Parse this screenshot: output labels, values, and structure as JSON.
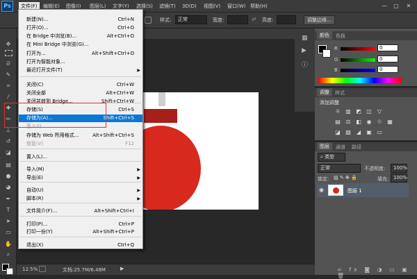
{
  "menubar": {
    "logo": "Ps",
    "items": [
      {
        "label": "文件(F)"
      },
      {
        "label": "编辑(E)"
      },
      {
        "label": "图像(I)"
      },
      {
        "label": "图层(L)"
      },
      {
        "label": "文字(Y)"
      },
      {
        "label": "选择(S)"
      },
      {
        "label": "滤镜(T)"
      },
      {
        "label": "3D(D)"
      },
      {
        "label": "视图(V)"
      },
      {
        "label": "窗口(W)"
      },
      {
        "label": "帮助(H)"
      }
    ],
    "window_buttons": [
      "—",
      "□",
      "✕"
    ]
  },
  "options": {
    "style_label": "样式:",
    "style_value": "正常",
    "width_label": "宽度:",
    "height_label": "高度:",
    "refine_edge": "调整边缘..."
  },
  "file_menu": {
    "items": [
      {
        "label": "新建(N)...",
        "shortcut": "Ctrl+N",
        "state": "normal",
        "submenu": false
      },
      {
        "label": "打开(O)...",
        "shortcut": "Ctrl+O",
        "state": "normal",
        "submenu": false
      },
      {
        "label": "在 Bridge 中浏览(B)...",
        "shortcut": "Alt+Ctrl+O",
        "state": "normal",
        "submenu": false
      },
      {
        "label": "在 Mini Bridge 中浏览(G)...",
        "shortcut": "",
        "state": "normal",
        "submenu": false
      },
      {
        "label": "打开为...",
        "shortcut": "Alt+Shift+Ctrl+O",
        "state": "normal",
        "submenu": false
      },
      {
        "label": "打开为智能对象...",
        "shortcut": "",
        "state": "normal",
        "submenu": false
      },
      {
        "label": "最近打开文件(T)",
        "shortcut": "",
        "state": "normal",
        "submenu": true
      },
      {
        "label": "关闭(C)",
        "shortcut": "Ctrl+W",
        "state": "normal",
        "submenu": false
      },
      {
        "label": "关闭全部",
        "shortcut": "Alt+Ctrl+W",
        "state": "normal",
        "submenu": false
      },
      {
        "label": "关闭并转到 Bridge...",
        "shortcut": "Shift+Ctrl+W",
        "state": "normal",
        "submenu": false
      },
      {
        "label": "存储(S)",
        "shortcut": "Ctrl+S",
        "state": "normal",
        "submenu": false
      },
      {
        "label": "存储为(A)...",
        "shortcut": "Shift+Ctrl+S",
        "state": "highlight",
        "submenu": false
      },
      {
        "label": "签入(I)...",
        "shortcut": "",
        "state": "disabled",
        "submenu": false
      },
      {
        "label": "存储为 Web 所用格式...",
        "shortcut": "Alt+Shift+Ctrl+S",
        "state": "normal",
        "submenu": false
      },
      {
        "label": "恢复(V)",
        "shortcut": "F12",
        "state": "disabled",
        "submenu": false
      },
      {
        "label": "置入(L)...",
        "shortcut": "",
        "state": "normal",
        "submenu": false
      },
      {
        "label": "导入(M)",
        "shortcut": "",
        "state": "normal",
        "submenu": true
      },
      {
        "label": "导出(E)",
        "shortcut": "",
        "state": "normal",
        "submenu": true
      },
      {
        "label": "自动(U)",
        "shortcut": "",
        "state": "normal",
        "submenu": true
      },
      {
        "label": "脚本(R)",
        "shortcut": "",
        "state": "normal",
        "submenu": true
      },
      {
        "label": "文件简介(F)...",
        "shortcut": "Alt+Shift+Ctrl+I",
        "state": "normal",
        "submenu": false
      },
      {
        "label": "打印(P)...",
        "shortcut": "Ctrl+P",
        "state": "normal",
        "submenu": false
      },
      {
        "label": "打印一份(Y)",
        "shortcut": "Alt+Shift+Ctrl+P",
        "state": "normal",
        "submenu": false
      },
      {
        "label": "退出(X)",
        "shortcut": "Ctrl+Q",
        "state": "normal",
        "submenu": false
      }
    ]
  },
  "status": {
    "zoom": "12.5%",
    "doc_size": "文档:25.7M/6.48M"
  },
  "color_panel": {
    "tabs": [
      "颜色",
      "色板"
    ],
    "channels": [
      {
        "name": "R",
        "value": "0"
      },
      {
        "name": "G",
        "value": "0"
      },
      {
        "name": "B",
        "value": "0"
      }
    ]
  },
  "adjust_panel": {
    "tabs": [
      "调整",
      "样式"
    ],
    "title": "添加调整"
  },
  "layers_panel": {
    "tabs": [
      "图层",
      "通道",
      "路径"
    ],
    "filter_kind": "类型",
    "blend_mode": "正常",
    "opacity_label": "不透明度:",
    "opacity_value": "100%",
    "lock_label": "锁定:",
    "fill_label": "填充:",
    "fill_value": "100%",
    "layer_name": "图层 1"
  },
  "colors": {
    "highlight": "#0c78d6",
    "annotation_box": "#e53030",
    "ornament_red": "#d8291f"
  }
}
